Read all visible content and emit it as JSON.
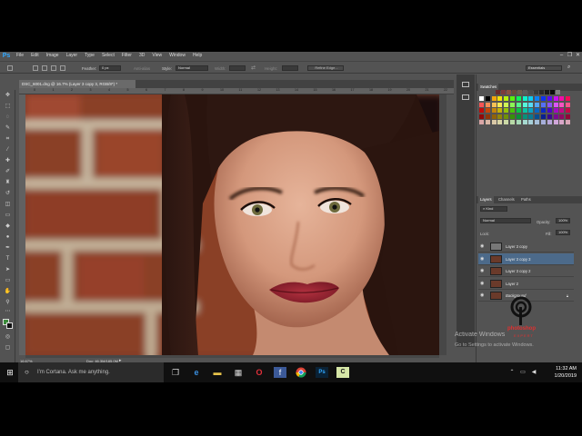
{
  "app": {
    "logo": "Ps",
    "menus": [
      "File",
      "Edit",
      "Image",
      "Layer",
      "Type",
      "Select",
      "Filter",
      "3D",
      "View",
      "Window",
      "Help"
    ],
    "window_controls": [
      "–",
      "❐",
      "✕"
    ]
  },
  "options_bar": {
    "feather_label": "Feather:",
    "feather_value": "0 px",
    "antialias_label": "Anti-alias",
    "style_label": "Style:",
    "style_value": "Normal",
    "width_label": "Width:",
    "height_label": "Height:",
    "refine_edge_label": "Refine Edge...",
    "workspace_value": "Essentials"
  },
  "document": {
    "tab_title": "DSC_6001.dng @ 16.7% (Layer 3 copy 3, RGB/8*) *",
    "zoom": "16.67%",
    "doc_info": "Doc: 46.3M/185.0M",
    "ruler_numbers": [
      "0",
      "1",
      "2",
      "3",
      "4",
      "5",
      "6",
      "7",
      "8",
      "9",
      "10",
      "11",
      "12",
      "13",
      "14",
      "15",
      "16",
      "17",
      "18",
      "19",
      "20",
      "21",
      "22"
    ]
  },
  "swatches_panel": {
    "title": "Swatches"
  },
  "layers_panel": {
    "tabs": [
      "Layers",
      "Channels",
      "Paths"
    ],
    "kind_label": "Kind",
    "blend_mode": "Normal",
    "opacity_label": "Opacity:",
    "opacity_value": "100%",
    "lock_label": "Lock:",
    "fill_label": "Fill:",
    "fill_value": "100%",
    "layers": [
      {
        "name": "Layer 3 copy",
        "selected": false,
        "italic": false
      },
      {
        "name": "Layer 3 copy 3",
        "selected": true,
        "italic": false
      },
      {
        "name": "Layer 3 copy 2",
        "selected": false,
        "italic": false
      },
      {
        "name": "Layer 2",
        "selected": false,
        "italic": false
      },
      {
        "name": "Background",
        "selected": false,
        "italic": true
      }
    ]
  },
  "watermark": {
    "activate_title": "Activate Windows",
    "activate_sub": "Go to Settings to activate Windows.",
    "brand_main": "photoshop",
    "brand_sub": "EXPERT"
  },
  "taskbar": {
    "cortana_placeholder": "I'm Cortana. Ask me anything.",
    "time": "11:32 AM",
    "date": "1/20/2019"
  },
  "colors": {
    "ps_blue": "#31a8ff",
    "selected_layer": "#4c6a8a",
    "panel_bg": "#535353",
    "taskbar": "#101010"
  }
}
